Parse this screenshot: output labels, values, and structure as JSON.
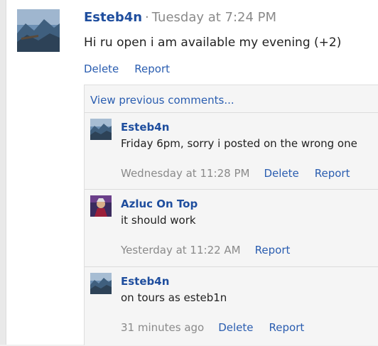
{
  "post": {
    "author": "Esteb4n",
    "separator": "·",
    "timestamp": "Tuesday at 7:24 PM",
    "text": "Hi ru open i am available my evening (+2)",
    "actions": {
      "delete": "Delete",
      "report": "Report"
    }
  },
  "comments_section": {
    "view_previous": "View previous comments...",
    "items": [
      {
        "author": "Esteb4n",
        "text": "Friday 6pm, sorry i posted on the wrong one",
        "timestamp": "Wednesday at 11:28 PM",
        "delete": "Delete",
        "report": "Report"
      },
      {
        "author": "Azluc On Top",
        "text": "it should work",
        "timestamp": "Yesterday at 11:22 AM",
        "report": "Report"
      },
      {
        "author": "Esteb4n",
        "text": "on tours as esteb1n",
        "timestamp": "31 minutes ago",
        "delete": "Delete",
        "report": "Report"
      }
    ]
  },
  "colors": {
    "link": "#2a5db0",
    "author": "#1f4e9e",
    "muted": "#8a8a8a",
    "panel": "#f5f5f5"
  }
}
